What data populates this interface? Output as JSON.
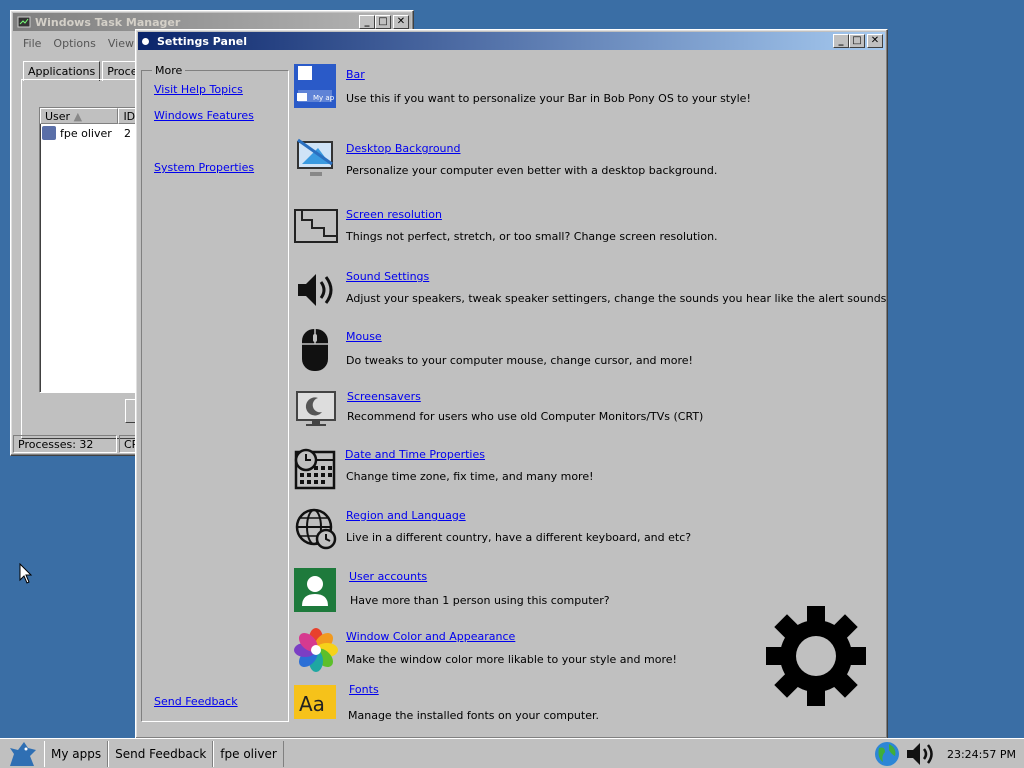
{
  "taskmgr": {
    "title": "Windows Task Manager",
    "menu": [
      "File",
      "Options",
      "View"
    ],
    "tabs": [
      "Applications",
      "Processes"
    ],
    "columns": [
      "User",
      "ID"
    ],
    "rows": [
      {
        "user": "fpe oliver",
        "id": "2"
      }
    ],
    "button_label": "D",
    "status_processes": "Processes: 32",
    "status_cpu": "CP"
  },
  "settings": {
    "title": "Settings Panel",
    "sidebar": {
      "legend": "More",
      "links": [
        "Visit Help Topics",
        "Windows Features",
        "System Properties"
      ],
      "feedback": "Send Feedback"
    },
    "items": [
      {
        "title": "Bar",
        "desc": "Use this if you want to personalize your Bar in Bob Pony OS to your style!",
        "icon": "bar-icon"
      },
      {
        "title": "Desktop Background",
        "desc": "Personalize your computer even better with a desktop background.",
        "icon": "monitor-brush-icon"
      },
      {
        "title": "Screen resolution",
        "desc": "Things not perfect, stretch, or too small? Change screen resolution.",
        "icon": "resolution-icon"
      },
      {
        "title": "Sound Settings",
        "desc": "Adjust your speakers, tweak speaker settingers, change the sounds you hear like the alert sounds",
        "icon": "speaker-icon"
      },
      {
        "title": "Mouse",
        "desc": "Do tweaks to your computer mouse, change cursor, and more!",
        "icon": "mouse-icon"
      },
      {
        "title": "Screensavers",
        "desc": "Recommend for users who use old Computer Monitors/TVs (CRT)",
        "icon": "screensaver-icon"
      },
      {
        "title": "Date and Time Properties",
        "desc": "Change time zone, fix time, and many more!",
        "icon": "calendar-clock-icon"
      },
      {
        "title": "Region and Language",
        "desc": "Live in a different country, have a different keyboard, and etc?",
        "icon": "globe-clock-icon"
      },
      {
        "title": "User accounts",
        "desc": "Have more than 1 person using this computer?",
        "icon": "user-icon"
      },
      {
        "title": "Window Color and Appearance",
        "desc": "Make the window color more likable to your style and more!",
        "icon": "color-wheel-icon"
      },
      {
        "title": "Fonts",
        "desc": "Manage the installed fonts on your computer.",
        "icon": "fonts-icon"
      }
    ]
  },
  "taskbar": {
    "buttons": [
      "My apps",
      "Send Feedback",
      "fpe oliver"
    ],
    "clock": "23:24:57 PM"
  }
}
